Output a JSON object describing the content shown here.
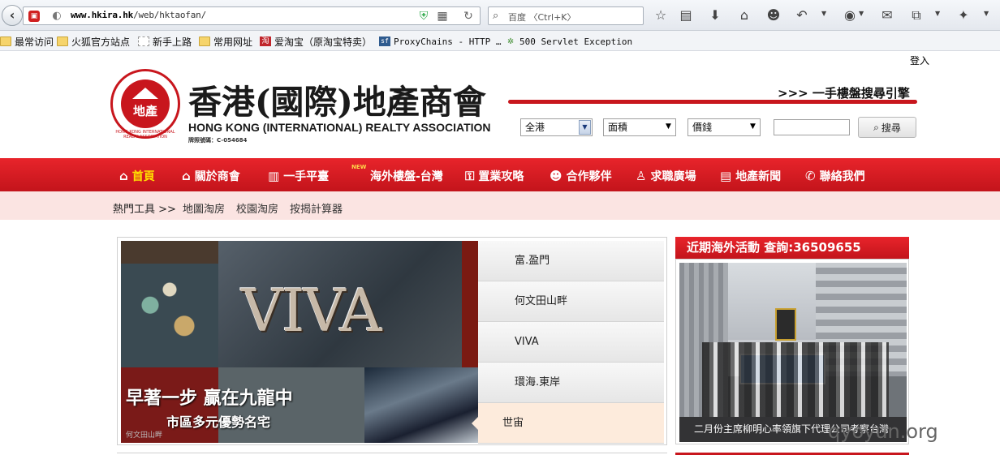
{
  "browser": {
    "url_host": "www.hkira.hk",
    "url_path": "/web/hktaofan/",
    "search_placeholder": "百度 〈Ctrl+K〉",
    "bookmarks": [
      {
        "label": "最常访问",
        "icon": "star-folder-icon"
      },
      {
        "label": "火狐官方站点",
        "icon": "folder-icon"
      },
      {
        "label": "新手上路",
        "icon": "page-icon"
      },
      {
        "label": "常用网址",
        "icon": "folder-icon"
      },
      {
        "label": "爱淘宝（原淘宝特卖）",
        "icon": "taobao-icon"
      },
      {
        "label": "ProxyChains - HTTP …",
        "icon": "sf-icon"
      },
      {
        "label": "500 Servlet Exception",
        "icon": "gear-icon"
      }
    ]
  },
  "header": {
    "login": "登入",
    "brand_cn": "香港(國際)地產商會",
    "brand_en": "HONG KONG (INTERNATIONAL) REALTY ASSOCIATION",
    "license": "牌照號碼：C-054684",
    "logo_text": "地產",
    "logo_ring": "HONG KONG INTERNATIONAL REALTY ASSOCIATION",
    "engine_title": ">>> 一手樓盤搜尋引擎",
    "region_select": "全港",
    "area_select": "面積",
    "price_select": "價錢",
    "search_button": "搜尋"
  },
  "nav": [
    {
      "label": "首頁",
      "icon": "home-icon"
    },
    {
      "label": "關於商會",
      "icon": "house-icon"
    },
    {
      "label": "一手平臺",
      "icon": "building-icon"
    },
    {
      "label": "海外樓盤-台灣",
      "icon": "new-badge-icon",
      "badge": "NEW"
    },
    {
      "label": "置業攻略",
      "icon": "key-icon"
    },
    {
      "label": "合作夥伴",
      "icon": "people-icon"
    },
    {
      "label": "求職廣場",
      "icon": "person-icon"
    },
    {
      "label": "地產新聞",
      "icon": "news-icon"
    },
    {
      "label": "聯絡我們",
      "icon": "phone-icon"
    }
  ],
  "hot_tools": {
    "title": "熱門工具 >>",
    "links": [
      "地圖淘房",
      "校園淘房",
      "按揭計算器"
    ]
  },
  "slider": {
    "viva": "VIVA",
    "headline": "早著一步 贏在九龍中",
    "subline": "市區多元優勢名宅",
    "caption": "何文田山畔",
    "tabs": [
      "富.盈門",
      "何文田山畔",
      "VIVA",
      "環海.東岸",
      "世宙"
    ],
    "active_index": 4
  },
  "overseas": {
    "title": "近期海外活動 查詢:36509655",
    "caption": "二月份主席柳明心率領旗下代理公司考察台灣"
  },
  "watermark": "qyoyun.org",
  "colors": {
    "brand_red": "#c8161d",
    "hot_tools_bg": "#fbe4e2"
  }
}
